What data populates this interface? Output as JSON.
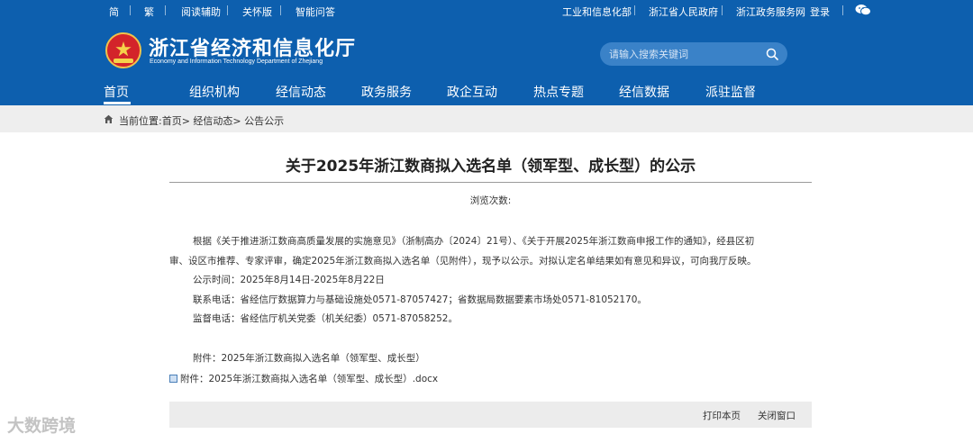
{
  "topbar": {
    "left_links": [
      "简",
      "繁",
      "阅读辅助",
      "关怀版",
      "智能问答"
    ],
    "right_links": [
      "工业和信息化部",
      "浙江省人民政府",
      "浙江政务服务网",
      "登录"
    ],
    "wechat_icon": "wechat-icon"
  },
  "site": {
    "title": "浙江省经济和信息化厅",
    "subtitle": "Economy and Information Technology Department of Zhejiang",
    "emblem_icon": "national-emblem-icon"
  },
  "search": {
    "placeholder": "请输入搜索关键词",
    "icon": "search-icon"
  },
  "nav": {
    "items": [
      "首页",
      "组织机构",
      "经信动态",
      "政务服务",
      "政企互动",
      "热点专题",
      "经信数据",
      "派驻监督"
    ],
    "active_index": 0
  },
  "breadcrumb": {
    "icon": "home-icon",
    "text": "当前位置:首页> 经信动态> 公告公示"
  },
  "article": {
    "title": "关于2025年浙江数商拟入选名单（领军型、成长型）的公示",
    "views_label": "浏览次数:",
    "para1_line1": "根据《关于推进浙江数商高质量发展的实施意见》（浙制高办〔2024〕21号）、《关于开展2025年浙江数商申报工作的通知》，经县区初",
    "para1_line2": "审、设区市推荐、专家评审，确定2025年浙江数商拟入选名单（见附件），现予以公示。对拟认定名单结果如有意见和异议，可向我厅反映。",
    "period": "公示时间：2025年8月14日-2025年8月22日",
    "contact": "联系电话：省经信厅数据算力与基础设施处0571-87057427；省数据局数据要素市场处0571-81052170。",
    "supervision": "监督电话：省经信厅机关党委（机关纪委）0571-87058252。",
    "attachment_note": "附件：2025年浙江数商拟入选名单（领军型、成长型）",
    "attachment_link": "附件：2025年浙江数商拟入选名单（领军型、成长型）.docx"
  },
  "footer": {
    "print": "打印本页",
    "close": "关闭窗口"
  },
  "watermark": {
    "text": "大数跨境"
  },
  "colors": {
    "header_bg": "#0d5fae",
    "search_bg": "#3a82c8",
    "breadcrumb_bg": "#eeeeee",
    "footer_bg": "#ececec"
  }
}
